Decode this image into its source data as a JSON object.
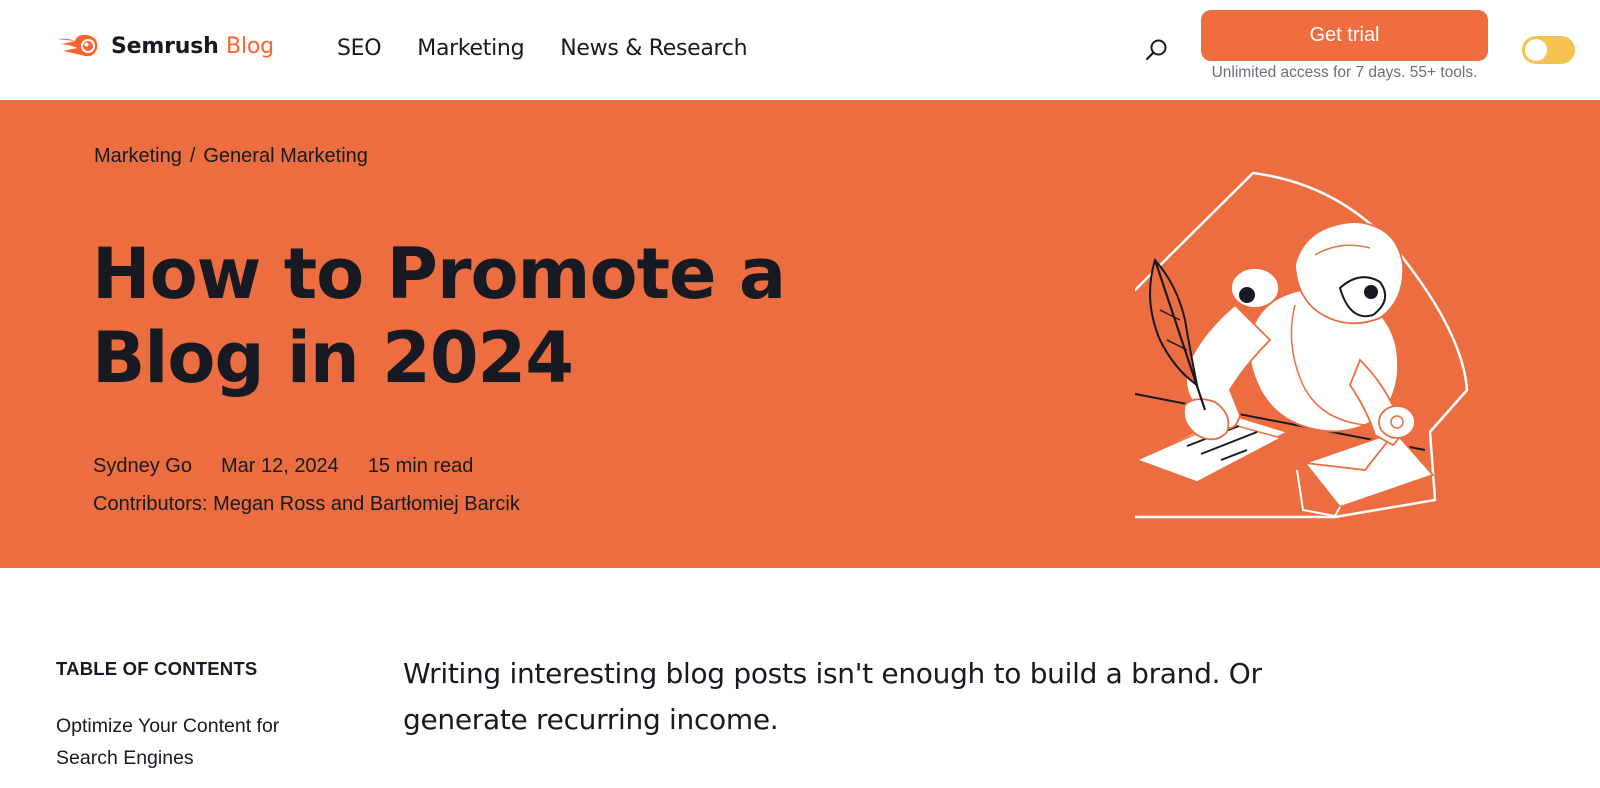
{
  "header": {
    "logo": {
      "brand": "Semrush",
      "section": "Blog"
    },
    "nav": [
      "SEO",
      "Marketing",
      "News & Research"
    ],
    "search_icon": "search-icon",
    "cta": {
      "label": "Get trial",
      "subtext": "Unlimited access for 7 days. 55+ tools."
    },
    "theme_toggle": "theme-toggle"
  },
  "hero": {
    "breadcrumb": [
      "Marketing",
      "/",
      "General Marketing"
    ],
    "title": "How to Promote a Blog in 2024",
    "author": "Sydney Go",
    "date": "Mar 12, 2024",
    "read_time": "15 min read",
    "contributors_prefix": "Contributors: ",
    "contributors": [
      "Megan Ross",
      " and ",
      "Bartłomiej Barcik"
    ],
    "illustration": "robot-writing-letter-illustration"
  },
  "toc": {
    "title": "TABLE OF CONTENTS",
    "items": [
      "Optimize Your Content for Search Engines"
    ]
  },
  "article": {
    "intro": "Writing interesting blog posts isn't enough to build a brand. Or generate recurring income."
  },
  "colors": {
    "accent": "#ff642d",
    "hero_bg": "#ec6e40",
    "cta_bg": "#ef6d3e",
    "toggle": "#f5c350",
    "text": "#171a22"
  }
}
